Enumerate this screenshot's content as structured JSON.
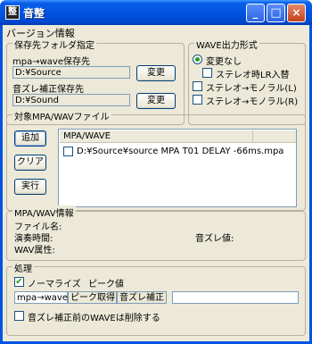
{
  "window": {
    "title": "音整",
    "icon_text": "整",
    "minimize_glyph": "_",
    "maximize_glyph": "□",
    "close_glyph": "×"
  },
  "menu": {
    "version_info": "バージョン情報"
  },
  "save_folder": {
    "group_label": "保存先フォルダ指定",
    "mpa_wave_label": "mpa→wave保存先",
    "mpa_wave_value": "D:¥Source",
    "sync_label": "音ズレ補正保存先",
    "sync_value": "D:¥Sound",
    "change_label": "変更"
  },
  "wave_output": {
    "group_label": "WAVE出力形式",
    "options": {
      "no_change": "変更なし",
      "swap_lr": "ステレオ時LR入替",
      "to_mono_l": "ステレオ→モノラル(L)",
      "to_mono_r": "ステレオ→モノラル(R)"
    }
  },
  "files": {
    "group_label": "対象MPA/WAVファイル",
    "add_label": "追加",
    "clear_label": "クリア",
    "run_label": "実行",
    "column_header": "MPA/WAVE",
    "rows": [
      "D:¥Source¥source MPA T01 DELAY -66ms.mpa"
    ]
  },
  "info": {
    "group_label": "MPA/WAV情報",
    "file_name_label": "ファイル名:",
    "play_time_label": "演奏時間:",
    "sync_gap_label": "音ズレ値:",
    "wav_attr_label": "WAV属性:"
  },
  "process": {
    "group_label": "処理",
    "normalize_label": "ノーマライズ",
    "peak_label": "ピーク値",
    "status_mpa_wave": "mpa→wave",
    "status_peak": "ピーク取得",
    "status_sync": "音ズレ補正",
    "delete_label": "音ズレ補正前のWAVEは削除する"
  }
}
